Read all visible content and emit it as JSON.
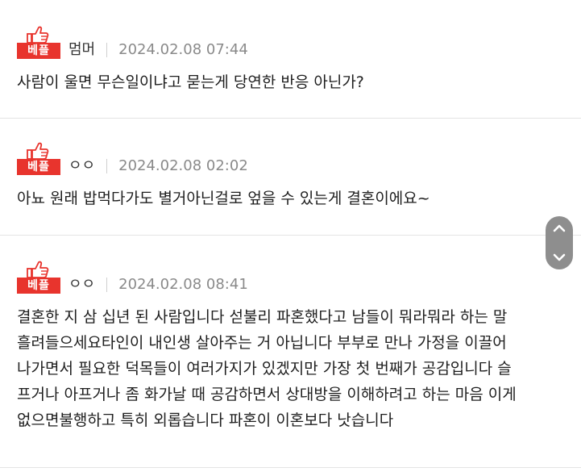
{
  "colors": {
    "best_badge": "#e8342d",
    "divider": "#e4e4e4",
    "timestamp": "#8a8a8a",
    "scroll_widget": "#8e8e8e"
  },
  "comments": [
    {
      "badge_icon": "thumbs-up-icon",
      "badge_label": "베플",
      "author": "멈머",
      "timestamp": "2024.02.08 07:44",
      "body": "사람이 울면 무슨일이냐고 묻는게 당연한 반응 아닌가?"
    },
    {
      "badge_icon": "thumbs-up-icon",
      "badge_label": "베플",
      "author": "ㅇㅇ",
      "timestamp": "2024.02.08 02:02",
      "body": "아뇨 원래 밥먹다가도 별거아닌걸로 엎을 수 있는게 결혼이에요~"
    },
    {
      "badge_icon": "thumbs-up-icon",
      "badge_label": "베플",
      "author": "ㅇㅇ",
      "timestamp": "2024.02.08 08:41",
      "body": "결혼한 지 삼 십년 된 사람입니다 섣불리 파혼했다고 남들이 뭐라뭐라 하는 말\n흘려들으세요타인이 내인생 살아주는 거 아닙니다 부부로 만나 가정을 이끌어\n나가면서 필요한 덕목들이 여러가지가 있겠지만 가장 첫 번째가 공감입니다 슬\n프거나 아프거나 좀 화가날 때 공감하면서 상대방을 이해하려고 하는 마음 이게\n없으면불행하고 특히 외롭습니다 파혼이 이혼보다 낫습니다"
    }
  ],
  "scroll_widget": {
    "up_icon": "chevron-up-icon",
    "down_icon": "chevron-down-icon"
  }
}
